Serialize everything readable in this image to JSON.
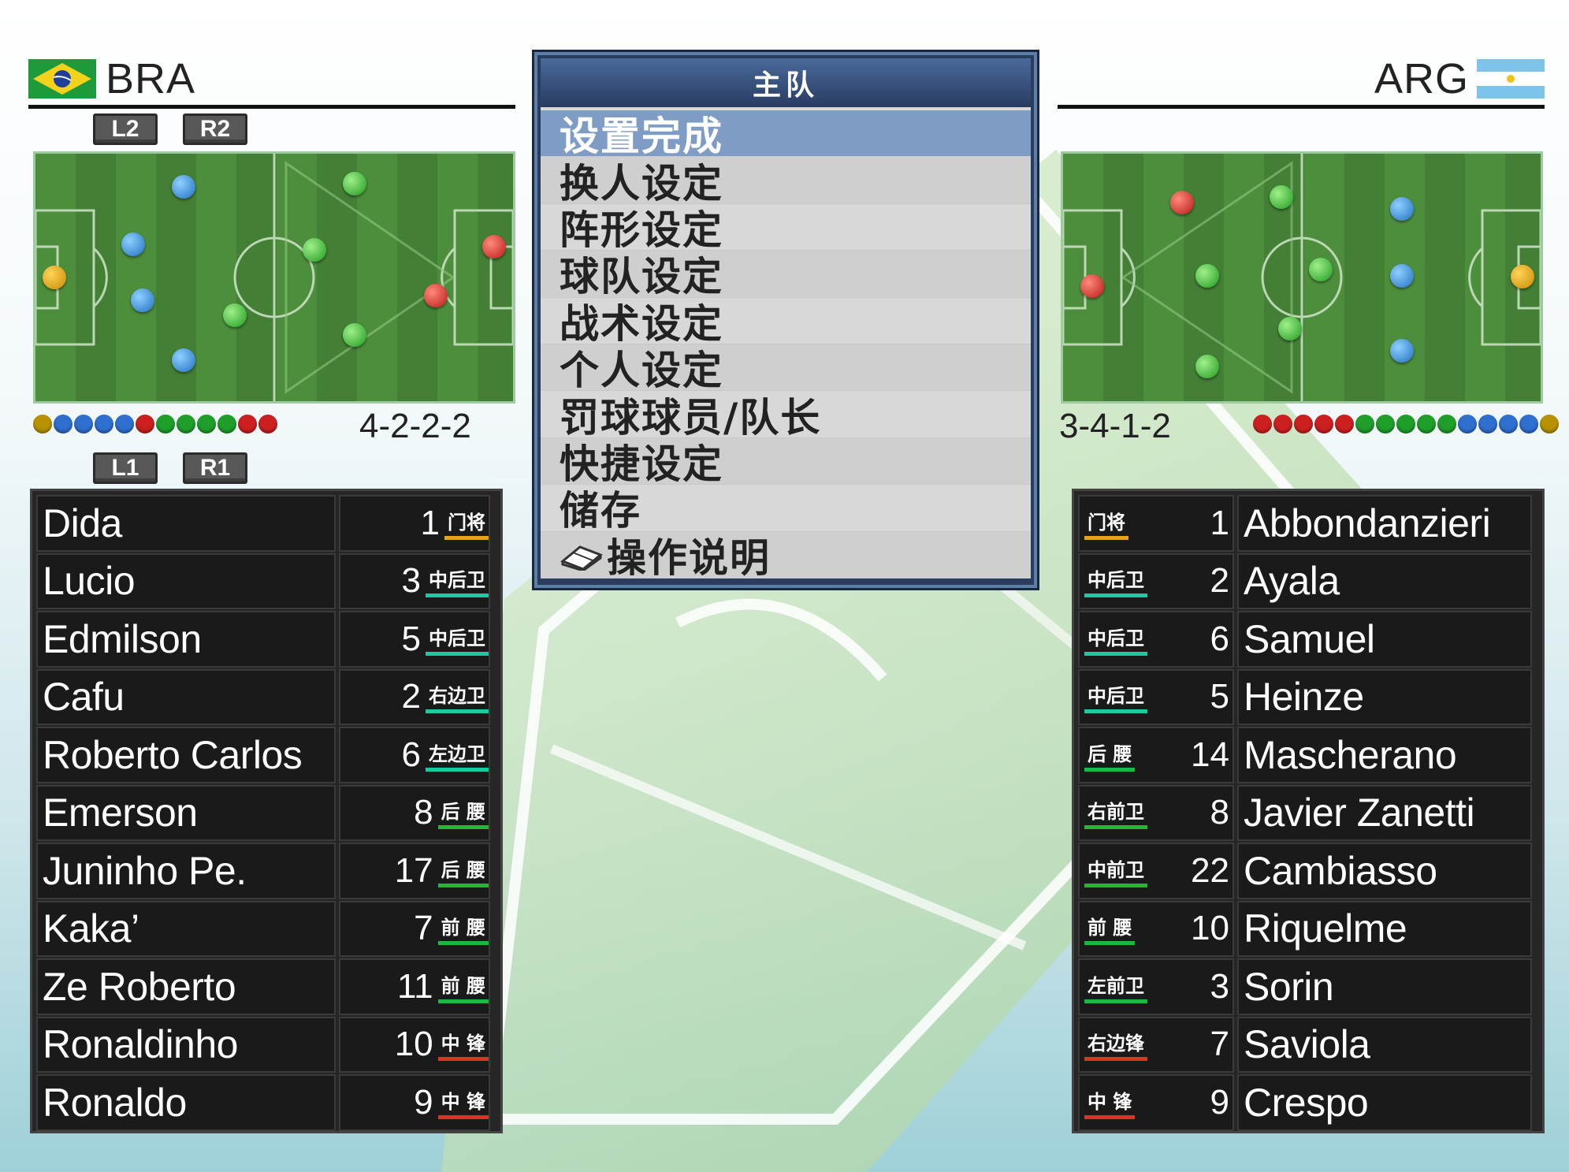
{
  "menu": {
    "title": "主队",
    "items": [
      {
        "label": "设置完成",
        "selected": true
      },
      {
        "label": "换人设定"
      },
      {
        "label": "阵形设定"
      },
      {
        "label": "球队设定"
      },
      {
        "label": "战术设定"
      },
      {
        "label": "个人设定"
      },
      {
        "label": "罚球球员/队长"
      },
      {
        "label": "快捷设定"
      },
      {
        "label": "储存"
      },
      {
        "label": "操作说明",
        "icon": "book-icon"
      }
    ]
  },
  "home": {
    "code": "BRA",
    "flag_icon": "brazil-flag-icon",
    "buttons_top": [
      "L2",
      "R2"
    ],
    "buttons_bottom": [
      "L1",
      "R1"
    ],
    "formation": "4-2-2-2",
    "strip_colors": [
      "#b89200",
      "#2f6fd0",
      "#2f6fd0",
      "#2f6fd0",
      "#2f6fd0",
      "#cc2020",
      "#1f9e2a",
      "#1f9e2a",
      "#1f9e2a",
      "#1f9e2a",
      "#cc2020",
      "#cc2020"
    ],
    "players": [
      {
        "name": "Dida",
        "number": "1",
        "position": "门将",
        "pos_color": "#e6a21a"
      },
      {
        "name": "Lucio",
        "number": "3",
        "position": "中后卫",
        "pos_color": "#1ec8a0"
      },
      {
        "name": "Edmilson",
        "number": "5",
        "position": "中后卫",
        "pos_color": "#1ec8a0"
      },
      {
        "name": "Cafu",
        "number": "2",
        "position": "右边卫",
        "pos_color": "#1ec8a0"
      },
      {
        "name": "Roberto Carlos",
        "number": "6",
        "position": "左边卫",
        "pos_color": "#1ec8a0"
      },
      {
        "name": "Emerson",
        "number": "8",
        "position": "后 腰",
        "pos_color": "#1fb83a"
      },
      {
        "name": "Juninho Pe.",
        "number": "17",
        "position": "后 腰",
        "pos_color": "#1fb83a"
      },
      {
        "name": "Kaka’",
        "number": "7",
        "position": "前 腰",
        "pos_color": "#1fb83a"
      },
      {
        "name": "Ze Roberto",
        "number": "11",
        "position": "前 腰",
        "pos_color": "#1fb83a"
      },
      {
        "name": "Ronaldinho",
        "number": "10",
        "position": "中 锋",
        "pos_color": "#e0302a"
      },
      {
        "name": "Ronaldo",
        "number": "9",
        "position": "中 锋",
        "pos_color": "#e0302a"
      }
    ]
  },
  "away": {
    "code": "ARG",
    "flag_icon": "argentina-flag-icon",
    "formation": "3-4-1-2",
    "strip_colors": [
      "#cc2020",
      "#cc2020",
      "#cc2020",
      "#cc2020",
      "#cc2020",
      "#1f9e2a",
      "#1f9e2a",
      "#1f9e2a",
      "#1f9e2a",
      "#1f9e2a",
      "#2f6fd0",
      "#2f6fd0",
      "#2f6fd0",
      "#2f6fd0",
      "#b89200"
    ],
    "players": [
      {
        "name": "Abbondanzieri",
        "number": "1",
        "position": "门将",
        "pos_color": "#e6a21a"
      },
      {
        "name": "Ayala",
        "number": "2",
        "position": "中后卫",
        "pos_color": "#1ec8a0"
      },
      {
        "name": "Samuel",
        "number": "6",
        "position": "中后卫",
        "pos_color": "#1ec8a0"
      },
      {
        "name": "Heinze",
        "number": "5",
        "position": "中后卫",
        "pos_color": "#1ec8a0"
      },
      {
        "name": "Mascherano",
        "number": "14",
        "position": "后 腰",
        "pos_color": "#1fb83a"
      },
      {
        "name": "Javier Zanetti",
        "number": "8",
        "position": "右前卫",
        "pos_color": "#1fb83a"
      },
      {
        "name": "Cambiasso",
        "number": "22",
        "position": "中前卫",
        "pos_color": "#1fb83a"
      },
      {
        "name": "Riquelme",
        "number": "10",
        "position": "前 腰",
        "pos_color": "#1fb83a"
      },
      {
        "name": "Sorin",
        "number": "3",
        "position": "左前卫",
        "pos_color": "#1fb83a"
      },
      {
        "name": "Saviola",
        "number": "7",
        "position": "右边锋",
        "pos_color": "#e0302a"
      },
      {
        "name": "Crespo",
        "number": "9",
        "position": "中 锋",
        "pos_color": "#e0302a"
      }
    ]
  },
  "colors": {
    "gk": "#e6a21a",
    "defender": "#2f88d8",
    "midfielder": "#33b530",
    "forward": "#d62a2a"
  }
}
